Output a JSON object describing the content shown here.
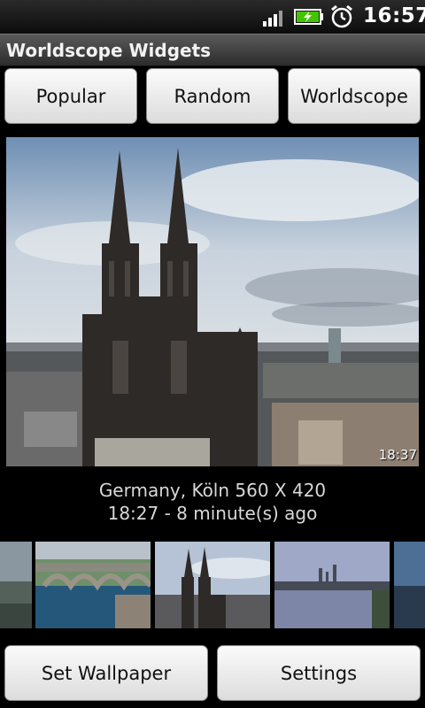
{
  "status_bar": {
    "time": "16:57",
    "icons": [
      "signal-icon",
      "battery-charging-icon",
      "alarm-clock-icon"
    ]
  },
  "app": {
    "title": "Worldscope Widgets"
  },
  "tabs": {
    "popular": "Popular",
    "random": "Random",
    "worldscope": "Worldscope"
  },
  "webcam": {
    "stamp": "18:37",
    "location_line": "Germany, Köln 560 X 420",
    "time_line": "18:27 - 8 minute(s) ago"
  },
  "gallery": {
    "thumbnails": [
      "partial-landscape",
      "bridge-over-river",
      "cologne-cathedral",
      "city-skyline-at-water",
      "partial-landscape"
    ],
    "selected_index": 2
  },
  "actions": {
    "set_wallpaper": "Set Wallpaper",
    "settings": "Settings"
  },
  "colors": {
    "battery_charge": "#44c400",
    "titlebar": "#4a4a4a",
    "button": "#efefef"
  }
}
